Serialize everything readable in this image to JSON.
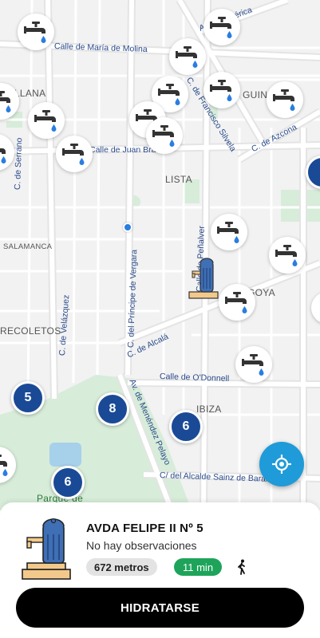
{
  "map": {
    "street_labels": {
      "america": "Av. de América",
      "maria_molina": "Calle de María de Molina",
      "francisco_silvela": "C. de Francisco Silvela",
      "azcona": "C. de Azcona",
      "serrano": "C. de Serrano",
      "juan_bravo": "Calle de Juan Bravo",
      "penalver": "Calle de Peñalver",
      "principe_vergara": "C. del Príncipe de Vergara",
      "velazquez": "C. de Velázquez",
      "alcala": "C. de Alcalá",
      "odonnell": "Calle de O'Donnell",
      "menendez_pelayo": "Av. de Menéndez Pelayo",
      "sainz_baranda": "C/ del Alcalde Sainz de Baranda"
    },
    "area_labels": {
      "castellana": "TELLANA",
      "guindalera": "GUIN",
      "lista": "LISTA",
      "salamanca": "SALAMANCA",
      "goya": "GOYA",
      "recoletos": "RECOLETOS",
      "ibiza": "IBIZA",
      "retiro": "Parque de"
    },
    "clusters": {
      "c1": "5",
      "c2": "8",
      "c3": "6",
      "c4": "6"
    },
    "tap_icon": "water-tap-icon",
    "selected_icon": "fountain-icon"
  },
  "locate_button": {
    "icon": "gps-locate-icon"
  },
  "sheet": {
    "name": "AVDA FELIPE II Nº 5",
    "observations": "No hay observaciones",
    "distance": "672 metros",
    "time": "11 min",
    "walk_icon": "walking-person-icon",
    "cta_label": "HIDRATARSE"
  },
  "colors": {
    "cluster": "#1a4a96",
    "locate": "#1e9bd8",
    "time_chip": "#1ea45a",
    "park": "#d7ecd9"
  }
}
